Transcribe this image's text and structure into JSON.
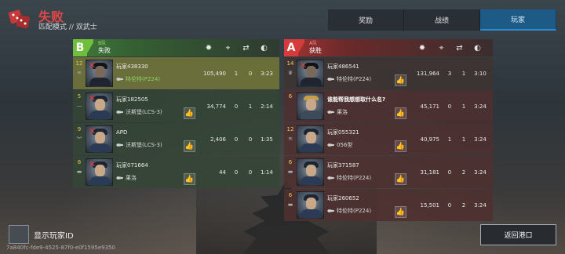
{
  "header": {
    "title": "失败",
    "subtitle": "匹配模式 // 双武士"
  },
  "tabs": [
    {
      "label": "奖励",
      "active": false
    },
    {
      "label": "战绩",
      "active": false
    },
    {
      "label": "玩家",
      "active": true
    }
  ],
  "colors": {
    "team_b": "#6fbf3d",
    "team_a": "#d63b3b",
    "active_tab": "#1d5b86",
    "defeat": "#e04848"
  },
  "column_icons": [
    "damage-icon",
    "kills-crosshair-icon",
    "assists-handshake-icon",
    "survival-time-icon"
  ],
  "team_b": {
    "letter": "B",
    "tag": "B队",
    "result": "失败",
    "players": [
      {
        "level": "12",
        "name": "玩家438330",
        "ship": "特伦特(P224)",
        "damage": "105,490",
        "kills": "1",
        "assists": "0",
        "time": "3:23",
        "dead": true,
        "me": true,
        "liked": false
      },
      {
        "level": "5",
        "name": "玩家182505",
        "ship": "沃斯堡(LCS-3)",
        "damage": "34,774",
        "kills": "0",
        "assists": "1",
        "time": "2:14",
        "dead": true,
        "me": false,
        "liked": false
      },
      {
        "level": "9",
        "name": "APD",
        "ship": "沃斯堡(LCS-3)",
        "damage": "2,406",
        "kills": "0",
        "assists": "0",
        "time": "1:35",
        "dead": true,
        "me": false,
        "liked": false
      },
      {
        "level": "8",
        "name": "玩家071664",
        "ship": "果洛",
        "damage": "44",
        "kills": "0",
        "assists": "0",
        "time": "1:14",
        "dead": true,
        "me": false,
        "liked": false
      }
    ]
  },
  "team_a": {
    "letter": "A",
    "tag": "A队",
    "result": "获胜",
    "players": [
      {
        "level": "14",
        "name": "玩家486541",
        "ship": "特伦特(P224)",
        "damage": "131,964",
        "kills": "3",
        "assists": "1",
        "time": "3:10",
        "dead": true,
        "liked": false
      },
      {
        "level": "6",
        "name": "谁能帮我想想取什么名?",
        "ship": "果洛",
        "damage": "45,171",
        "kills": "0",
        "assists": "1",
        "time": "3:24",
        "dead": false,
        "liked": false
      },
      {
        "level": "12",
        "name": "玩家055321",
        "ship": "056型",
        "damage": "40,975",
        "kills": "1",
        "assists": "1",
        "time": "3:24",
        "dead": false,
        "liked": false
      },
      {
        "level": "6",
        "name": "玩家371587",
        "ship": "特伦特(P224)",
        "damage": "31,181",
        "kills": "0",
        "assists": "2",
        "time": "3:24",
        "dead": false,
        "liked": false
      },
      {
        "level": "6",
        "name": "玩家260652",
        "ship": "特伦特(P224)",
        "damage": "15,501",
        "kills": "0",
        "assists": "2",
        "time": "3:24",
        "dead": false,
        "liked": false
      }
    ]
  },
  "footer": {
    "show_id_label": "显示玩家ID",
    "build_id": "7a840fc-fde9-4525-87f0-e0f1595e9350",
    "exit_label": "返回港口"
  }
}
